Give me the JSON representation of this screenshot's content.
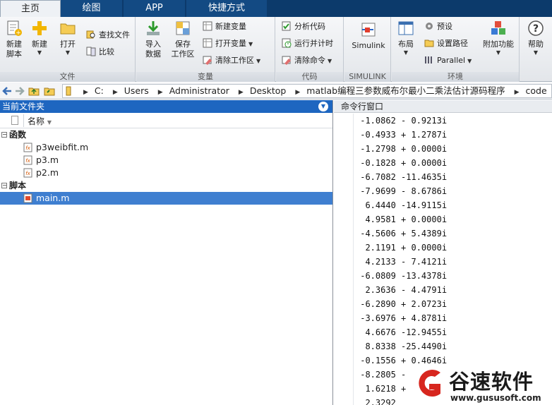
{
  "tabs": [
    "主页",
    "绘图",
    "APP",
    "快捷方式"
  ],
  "ribbon": {
    "file": {
      "label": "文件",
      "new_script": "新建\n脚本",
      "new": "新建",
      "open": "打开",
      "find_files": "查找文件",
      "compare": "比较"
    },
    "variable": {
      "label": "变量",
      "import": "导入\n数据",
      "save_workspace": "保存\n工作区",
      "new_variable": "新建变量",
      "open_variable": "打开变量",
      "clear_workspace": "清除工作区"
    },
    "code": {
      "label": "代码",
      "analyze": "分析代码",
      "run_time": "运行并计时",
      "clear_commands": "清除命令"
    },
    "simulink": {
      "label": "SIMULINK",
      "simulink": "Simulink"
    },
    "environment": {
      "label": "环境",
      "layout": "布局",
      "preferences": "预设",
      "set_path": "设置路径",
      "parallel": "Parallel",
      "addons": "附加功能",
      "help": "帮助"
    }
  },
  "address": {
    "crumbs": [
      "C:",
      "Users",
      "Administrator",
      "Desktop",
      "matlab编程三参数威布尔最小二乘法估计源码程序",
      "code"
    ]
  },
  "current_folder": {
    "title": "当前文件夹",
    "column_name": "名称",
    "groups": [
      {
        "name": "函数",
        "files": [
          "p3weibfit.m",
          "p3.m",
          "p2.m"
        ]
      },
      {
        "name": "脚本",
        "files": [
          "main.m"
        ]
      }
    ],
    "selected_file": "main.m"
  },
  "command_window": {
    "title": "命令行窗口",
    "lines": [
      " -1.0862 - 0.9213i",
      " -0.4933 + 1.2787i",
      " -1.2798 + 0.0000i",
      " -0.1828 + 0.0000i",
      " -6.7082 -11.4635i",
      " -7.9699 - 8.6786i",
      "  6.4440 -14.9115i",
      "  4.9581 + 0.0000i",
      " -4.5606 + 5.4389i",
      "  2.1191 + 0.0000i",
      "  4.2133 - 7.4121i",
      " -6.0809 -13.4378i",
      "  2.3636 - 4.4791i",
      " -6.2890 + 2.0723i",
      " -3.6976 + 4.8781i",
      "  4.6676 -12.9455i",
      "  8.8338 -25.4490i",
      " -0.1556 + 0.4646i",
      " -8.2805 -",
      "  1.6218 +",
      "  2.3292"
    ]
  },
  "watermark": {
    "name": "谷速软件",
    "url": "www.gususoft.com"
  },
  "colors": {
    "tabbar": "#0c3a6b",
    "panel_title": "#1e66c0",
    "selection": "#3f7fd0"
  }
}
